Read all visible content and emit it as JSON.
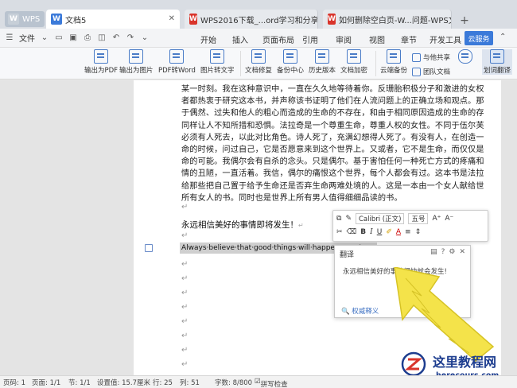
{
  "tabs": {
    "wps": "WPS",
    "doc": "文档5",
    "t3": "WPS2016下载_...ord学习和分享平台",
    "t4": "如何删除空白页-W...问题-WPS文字-",
    "add": "+"
  },
  "menu": {
    "file": "文件",
    "items": [
      "开始",
      "插入",
      "页面布局",
      "引用",
      "审阅",
      "视图",
      "章节",
      "开发工具"
    ],
    "cloud": "云服务"
  },
  "ribbon": {
    "to_pdf": "输出为PDF",
    "to_image": "输出为图片",
    "pdf_to_word": "PDF转Word",
    "image_to_text": "图片转文字",
    "doc_repair": "文档修复",
    "backup_center": "备份中心",
    "history": "历史版本",
    "encrypt": "文档加密",
    "cloud_backup": "云端备份",
    "share_with": "与他共享",
    "team_doc": "团队文档",
    "dictation": "语音",
    "translate": "划词翻译"
  },
  "document": {
    "lines": [
      "某一时刻。我在这种意识中，一直在久久地等待着你。反珊胎积极分子和激进的女权主义",
      "者都热衷于研究这本书，并声称该书证明了他们在人流问题上的正确立场和观点。那种由",
      "于偶然、过失和他人的粗心而造成的生命的不存在，和由于相同原因造成的生命的存在，",
      "同样让人不知所措和恐惧。法拉奇是一个尊重生命，尊重人权的女性。不同于伍尔芙，作品中",
      "必须有人死去，以此对比角色。诗人死了，充满幻想得人死了。有没有人，在创造一个生",
      "命的时候，问过自己，它是否愿意来到这个世界上。又或者，它不是生命，而仅仅是一种生",
      "命的可能。我偶尔会有自杀的念头。只是偶尔。基于害怕任何一种死亡方式的疼痛和死亡表",
      "情的丑陋，一直活着。我信，偶尔的痛恨这个世界，每个人都会有过。这本书是法拉奇献",
      "给那些把自己置于给予生命还是否弃生命两难处境的人。这是一本由一个女人献给世界上",
      "所有女人的书。同时也是世界上所有男人值得细细品读的书。"
    ],
    "heading": "永远相信美好的事情即将发生！",
    "english": "Always·believe·that·good·things·will·happen·soon!",
    "return_mark": "↵"
  },
  "float_toolbar": {
    "font": "Calibri (正文)",
    "size": "五号",
    "bold": "B",
    "italic": "I",
    "underline": "U"
  },
  "translate_popup": {
    "title": "翻译",
    "result": "永远相信美好的事情很快就会发生!",
    "link": "权威释义"
  },
  "status": {
    "page_num": "页码: 1",
    "pages": "页面: 1/1",
    "section": "节: 1/1",
    "setting": "设置值: 15.7厘米",
    "row": "行: 25",
    "col": "列: 51",
    "words": "字数: 8/800",
    "spell": "拼写检查"
  },
  "watermark": {
    "title": "这里教程网",
    "url": "herecours.com"
  },
  "colors": {
    "accent": "#3b7ad9",
    "wps_red": "#d9342b"
  }
}
